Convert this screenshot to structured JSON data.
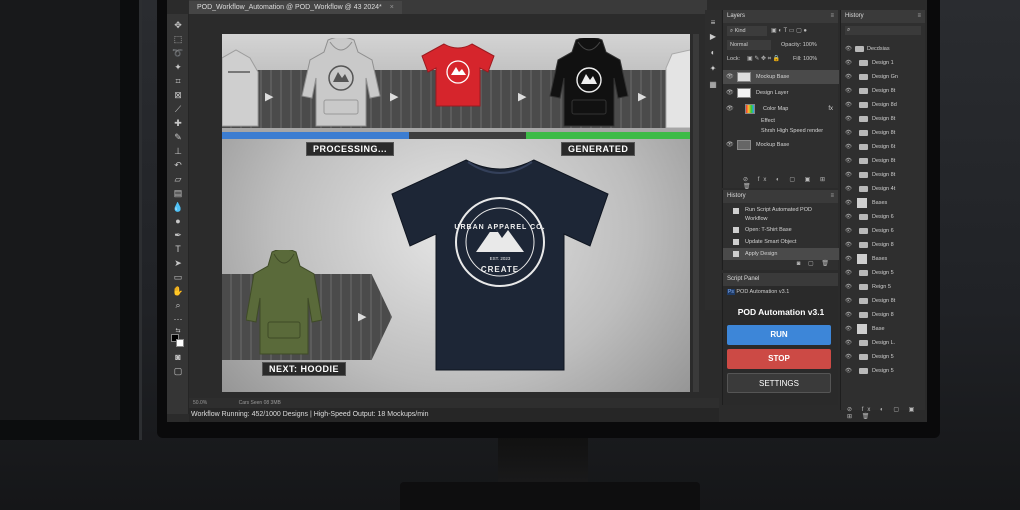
{
  "window": {
    "tab_title": "POD_Workflow_Automation @ POD_Workflow @ 43 2024*"
  },
  "canvas": {
    "label_processing": "PROCESSING...",
    "label_generated": "GENERATED",
    "label_next": "NEXT: HOODIE",
    "progress_processing_fraction": 0.4,
    "progress_generated_fraction": 0.35,
    "main_shirt_text_top": "URBAN APPAREL CO.",
    "main_shirt_text_est": "EST. 2023",
    "main_shirt_text_bottom": "CREATE"
  },
  "statusbar": {
    "zoom": "50.0%",
    "doc_info": "Cars Seen 08 3MB"
  },
  "footer": {
    "status_text": "Workflow Running: 452/1000 Designs | High-Speed Output: 18 Mockups/min"
  },
  "layers_panel": {
    "title": "Layers",
    "kind_label": "Kind",
    "blend_mode": "Normal",
    "opacity_label": "Opacity: 100%",
    "lock_label": "Lock:",
    "fill_label": "Fill: 100%",
    "rows": [
      {
        "name": "Mockup Base",
        "selected": true
      },
      {
        "name": "Design Layer",
        "selected": false
      },
      {
        "name": "Color Map",
        "selected": false
      },
      {
        "name": "Effect",
        "selected": false
      },
      {
        "name": "Shrsh High Speed render",
        "selected": false
      },
      {
        "name": "Mockup Base",
        "selected": false
      }
    ]
  },
  "history_panel": {
    "title": "History",
    "items": [
      "Run Script Automated POD Workflow",
      "Open: T-Shirt Base",
      "Update Smart Object",
      "Apply Design"
    ]
  },
  "script_panel": {
    "title": "Script Panel",
    "script_file": "POD Automation v3.1",
    "heading": "POD Automation v3.1",
    "run_label": "RUN",
    "stop_label": "STOP",
    "settings_label": "SETTINGS",
    "colors": {
      "run": "#3d86d8",
      "stop": "#cc4a45",
      "settings": "#3a3a3a"
    }
  },
  "history_right": {
    "title": "History",
    "root": "Decdsias",
    "items": [
      "Design 1",
      "Design Gn",
      "Design 8t",
      "Design 8d",
      "Design 8t",
      "Design 8t",
      "Design 6t",
      "Design 8t",
      "Design 8t",
      "Design 4t",
      "Bases",
      "Design 6",
      "Design 6",
      "Design 8",
      "Bases",
      "Design 5",
      "Reign 5",
      "Design 8t",
      "Design 8",
      "Base",
      "Design L.",
      "Design 5",
      "Design 5"
    ]
  }
}
